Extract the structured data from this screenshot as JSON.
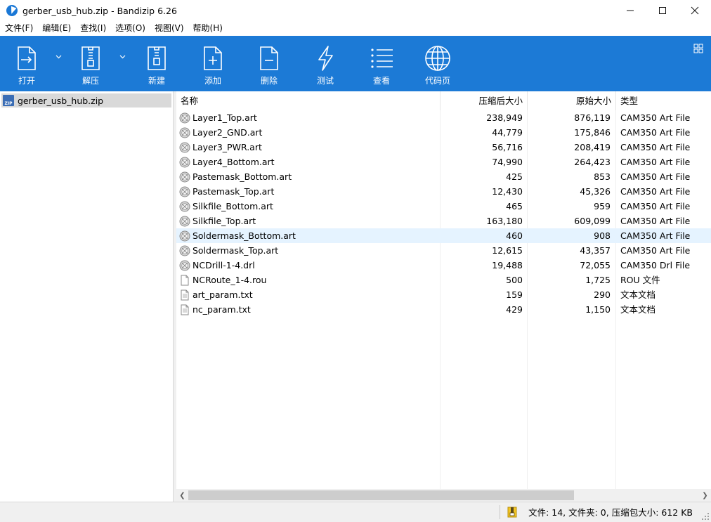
{
  "window": {
    "title": "gerber_usb_hub.zip - Bandizip 6.26",
    "minimize": "—",
    "maximize": "☐",
    "close": "✕"
  },
  "menu": [
    "文件(F)",
    "编辑(E)",
    "查找(I)",
    "选项(O)",
    "视图(V)",
    "帮助(H)"
  ],
  "toolbar": {
    "open": "打开",
    "extract": "解压",
    "new": "新建",
    "add": "添加",
    "delete": "删除",
    "test": "测试",
    "view": "查看",
    "codepage": "代码页"
  },
  "tree": {
    "root": "gerber_usb_hub.zip"
  },
  "columns": {
    "name": "名称",
    "packed": "压缩后大小",
    "original": "原始大小",
    "type": "类型"
  },
  "files": [
    {
      "name": "Layer1_Top.art",
      "packed": "238,949",
      "original": "876,119",
      "type": "CAM350 Art File",
      "icon": "cam-file-icon"
    },
    {
      "name": "Layer2_GND.art",
      "packed": "44,779",
      "original": "175,846",
      "type": "CAM350 Art File",
      "icon": "cam-file-icon"
    },
    {
      "name": "Layer3_PWR.art",
      "packed": "56,716",
      "original": "208,419",
      "type": "CAM350 Art File",
      "icon": "cam-file-icon"
    },
    {
      "name": "Layer4_Bottom.art",
      "packed": "74,990",
      "original": "264,423",
      "type": "CAM350 Art File",
      "icon": "cam-file-icon"
    },
    {
      "name": "Pastemask_Bottom.art",
      "packed": "425",
      "original": "853",
      "type": "CAM350 Art File",
      "icon": "cam-file-icon"
    },
    {
      "name": "Pastemask_Top.art",
      "packed": "12,430",
      "original": "45,326",
      "type": "CAM350 Art File",
      "icon": "cam-file-icon"
    },
    {
      "name": "Silkfile_Bottom.art",
      "packed": "465",
      "original": "959",
      "type": "CAM350 Art File",
      "icon": "cam-file-icon"
    },
    {
      "name": "Silkfile_Top.art",
      "packed": "163,180",
      "original": "609,099",
      "type": "CAM350 Art File",
      "icon": "cam-file-icon"
    },
    {
      "name": "Soldermask_Bottom.art",
      "packed": "460",
      "original": "908",
      "type": "CAM350 Art File",
      "icon": "cam-file-icon"
    },
    {
      "name": "Soldermask_Top.art",
      "packed": "12,615",
      "original": "43,357",
      "type": "CAM350 Art File",
      "icon": "cam-file-icon"
    },
    {
      "name": "NCDrill-1-4.drl",
      "packed": "19,488",
      "original": "72,055",
      "type": "CAM350 Drl File",
      "icon": "cam-file-icon"
    },
    {
      "name": "NCRoute_1-4.rou",
      "packed": "500",
      "original": "1,725",
      "type": "ROU 文件",
      "icon": "blank-file-icon"
    },
    {
      "name": "art_param.txt",
      "packed": "159",
      "original": "290",
      "type": "文本文档",
      "icon": "text-file-icon"
    },
    {
      "name": "nc_param.txt",
      "packed": "429",
      "original": "1,150",
      "type": "文本文档",
      "icon": "text-file-icon"
    }
  ],
  "hover_row_index": 8,
  "status": {
    "text": "文件: 14, 文件夹: 0, 压缩包大小: 612 KB"
  },
  "colors": {
    "toolbar": "#1c7ad6",
    "hover_row": "#e5f3ff",
    "tree_selected": "#d9d9d9"
  }
}
